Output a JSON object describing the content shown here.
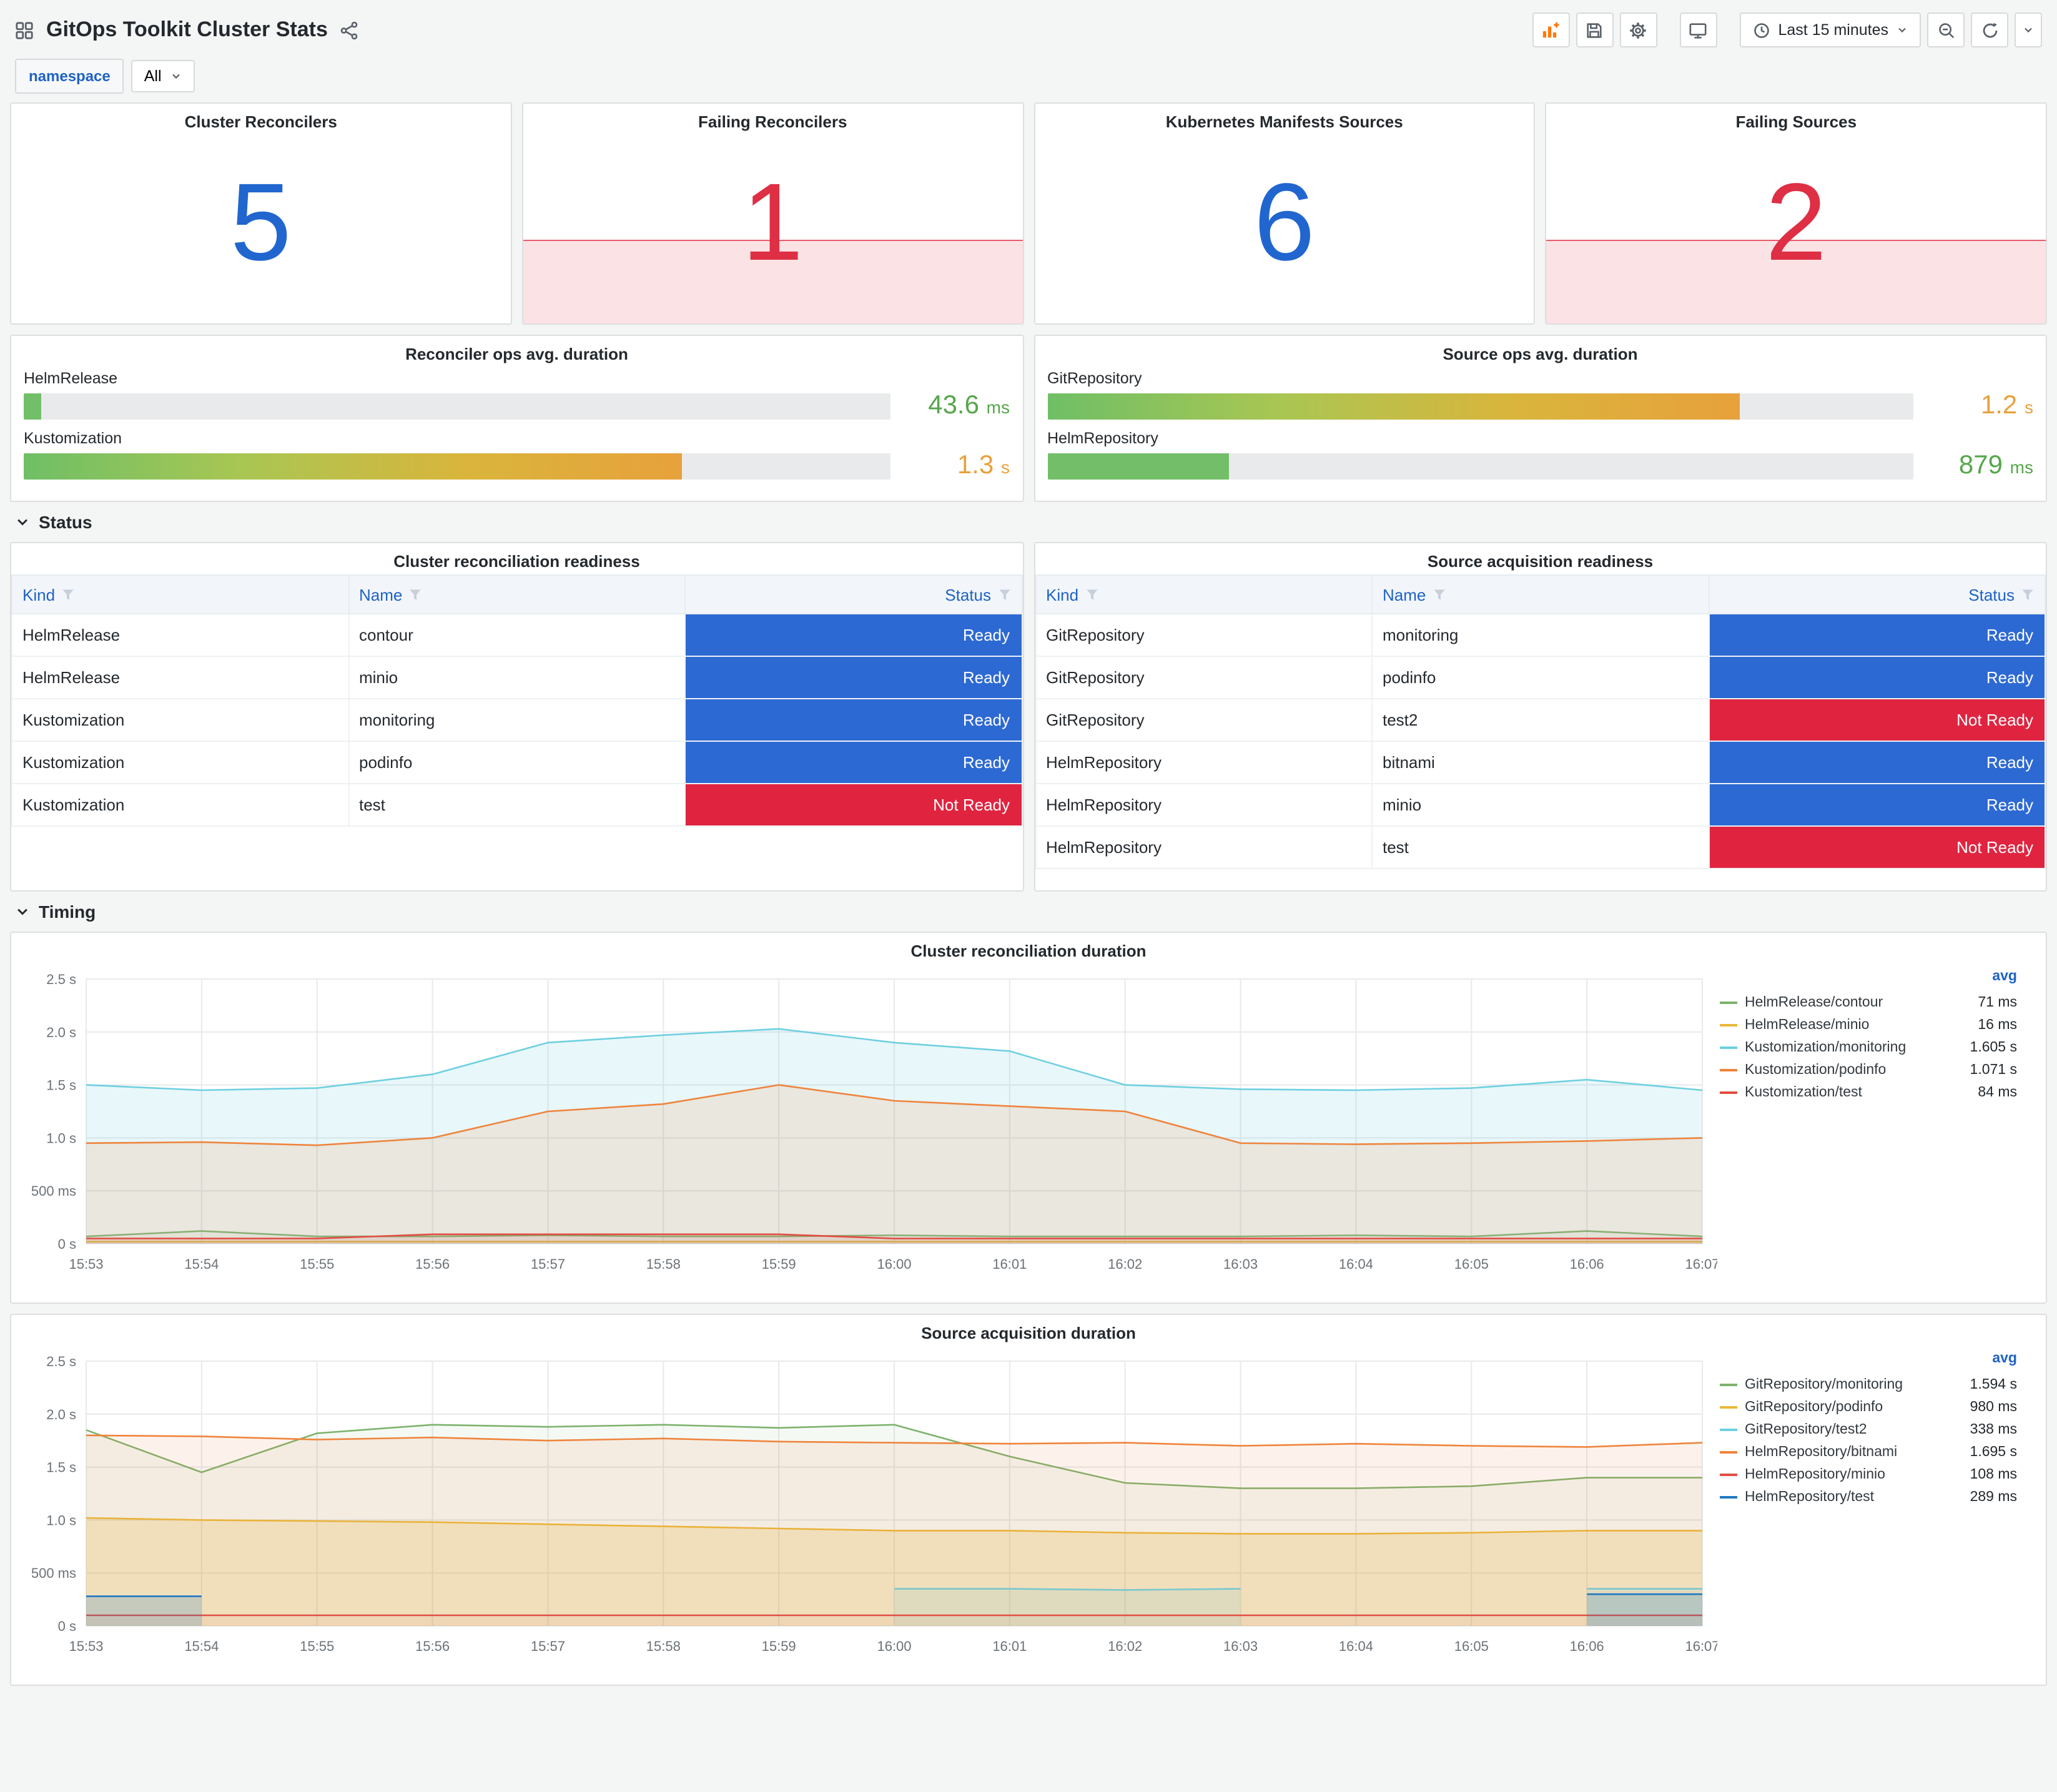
{
  "colors": {
    "stat_blue": "#2166CF",
    "stat_red": "#DE2F44",
    "ready_blue": "#2D69D3",
    "not_ready_red": "#E02440",
    "green_value": "#56A64B",
    "amber_value": "#E8A13C",
    "link_blue": "#1F62C4"
  },
  "icons": {
    "dashboard-grid-icon": "grid-of-squares",
    "share-icon": "share-nodes",
    "add-panel-icon": "bar-chart-plus (orange)",
    "save-icon": "floppy-disk",
    "settings-icon": "gear",
    "tv-icon": "monitor",
    "clock-icon": "clock",
    "zoom-out-icon": "magnifier-minus",
    "refresh-icon": "circular-arrow",
    "caret-icon": "chevron-down",
    "filter-icon": "funnel",
    "section-chevron-icon": "chevron-down"
  },
  "header": {
    "title": "GitOps Toolkit Cluster Stats",
    "time_range": "Last 15 minutes"
  },
  "variables": {
    "label": "namespace",
    "value": "All"
  },
  "sections": {
    "status": "Status",
    "timing": "Timing"
  },
  "stats": [
    {
      "title": "Cluster Reconcilers",
      "value": "5",
      "state": "ok"
    },
    {
      "title": "Failing Reconcilers",
      "value": "1",
      "state": "failing"
    },
    {
      "title": "Kubernetes Manifests Sources",
      "value": "6",
      "state": "ok"
    },
    {
      "title": "Failing Sources",
      "value": "2",
      "state": "failing"
    }
  ],
  "gauges": [
    {
      "title": "Reconciler ops avg. duration",
      "rows": [
        {
          "label": "HelmRelease",
          "num": "43.6",
          "unit": "ms",
          "pct": 2,
          "bar": "green",
          "value_color": "green"
        },
        {
          "label": "Kustomization",
          "num": "1.3",
          "unit": "s",
          "pct": 76,
          "bar": "gradient",
          "value_color": "amber"
        }
      ]
    },
    {
      "title": "Source ops avg. duration",
      "rows": [
        {
          "label": "GitRepository",
          "num": "1.2",
          "unit": "s",
          "pct": 80,
          "bar": "gradient",
          "value_color": "amber"
        },
        {
          "label": "HelmRepository",
          "num": "879",
          "unit": "ms",
          "pct": 21,
          "bar": "green",
          "value_color": "green"
        }
      ]
    }
  ],
  "tables": [
    {
      "title": "Cluster reconciliation readiness",
      "columns": [
        "Kind",
        "Name",
        "Status"
      ],
      "rows": [
        {
          "kind": "HelmRelease",
          "name": "contour",
          "status": "Ready",
          "state": "ready"
        },
        {
          "kind": "HelmRelease",
          "name": "minio",
          "status": "Ready",
          "state": "ready"
        },
        {
          "kind": "Kustomization",
          "name": "monitoring",
          "status": "Ready",
          "state": "ready"
        },
        {
          "kind": "Kustomization",
          "name": "podinfo",
          "status": "Ready",
          "state": "ready"
        },
        {
          "kind": "Kustomization",
          "name": "test",
          "status": "Not Ready",
          "state": "not-ready"
        }
      ]
    },
    {
      "title": "Source acquisition readiness",
      "columns": [
        "Kind",
        "Name",
        "Status"
      ],
      "rows": [
        {
          "kind": "GitRepository",
          "name": "monitoring",
          "status": "Ready",
          "state": "ready"
        },
        {
          "kind": "GitRepository",
          "name": "podinfo",
          "status": "Ready",
          "state": "ready"
        },
        {
          "kind": "GitRepository",
          "name": "test2",
          "status": "Not Ready",
          "state": "not-ready"
        },
        {
          "kind": "HelmRepository",
          "name": "bitnami",
          "status": "Ready",
          "state": "ready"
        },
        {
          "kind": "HelmRepository",
          "name": "minio",
          "status": "Ready",
          "state": "ready"
        },
        {
          "kind": "HelmRepository",
          "name": "test",
          "status": "Not Ready",
          "state": "not-ready"
        }
      ]
    }
  ],
  "charts": [
    {
      "type": "line",
      "title": "Cluster reconciliation duration",
      "legend_header": "avg",
      "ymax": 2.5,
      "yticks": [
        {
          "v": 0,
          "label": "0 s"
        },
        {
          "v": 0.5,
          "label": "500 ms"
        },
        {
          "v": 1,
          "label": "1.0 s"
        },
        {
          "v": 1.5,
          "label": "1.5 s"
        },
        {
          "v": 2,
          "label": "2.0 s"
        },
        {
          "v": 2.5,
          "label": "2.5 s"
        }
      ],
      "x": [
        "15:53",
        "15:54",
        "15:55",
        "15:56",
        "15:57",
        "15:58",
        "15:59",
        "16:00",
        "16:01",
        "16:02",
        "16:03",
        "16:04",
        "16:05",
        "16:06",
        "16:07"
      ],
      "series": [
        {
          "name": "HelmRelease/contour",
          "avg": "71 ms",
          "color": "#7EB26D",
          "fill": 0.06,
          "values": [
            0.07,
            0.12,
            0.07,
            0.07,
            0.08,
            0.07,
            0.07,
            0.08,
            0.07,
            0.07,
            0.07,
            0.08,
            0.07,
            0.12,
            0.07
          ]
        },
        {
          "name": "HelmRelease/minio",
          "avg": "16 ms",
          "color": "#EAB839",
          "fill": 0.05,
          "values": [
            0.02,
            0.02,
            0.02,
            0.02,
            0.02,
            0.02,
            0.02,
            0.02,
            0.02,
            0.02,
            0.02,
            0.02,
            0.02,
            0.02,
            0.02
          ]
        },
        {
          "name": "Kustomization/monitoring",
          "avg": "1.605 s",
          "color": "#6ED0E0",
          "fill": 0.16,
          "values": [
            1.5,
            1.45,
            1.47,
            1.6,
            1.9,
            1.97,
            2.03,
            1.9,
            1.82,
            1.5,
            1.46,
            1.45,
            1.47,
            1.55,
            1.45
          ]
        },
        {
          "name": "Kustomization/podinfo",
          "avg": "1.071 s",
          "color": "#EF843C",
          "fill": 0.14,
          "values": [
            0.95,
            0.96,
            0.93,
            1.0,
            1.25,
            1.32,
            1.5,
            1.35,
            1.3,
            1.25,
            0.95,
            0.94,
            0.95,
            0.97,
            1.0
          ]
        },
        {
          "name": "Kustomization/test",
          "avg": "84 ms",
          "color": "#E24D42",
          "fill": 0.1,
          "values": [
            0.05,
            0.05,
            0.05,
            0.09,
            0.09,
            0.09,
            0.09,
            0.05,
            0.05,
            0.05,
            0.05,
            0.05,
            0.05,
            0.05,
            0.05
          ]
        }
      ]
    },
    {
      "type": "line",
      "title": "Source acquisition duration",
      "legend_header": "avg",
      "ymax": 2.5,
      "yticks": [
        {
          "v": 0,
          "label": "0 s"
        },
        {
          "v": 0.5,
          "label": "500 ms"
        },
        {
          "v": 1,
          "label": "1.0 s"
        },
        {
          "v": 1.5,
          "label": "1.5 s"
        },
        {
          "v": 2,
          "label": "2.0 s"
        },
        {
          "v": 2.5,
          "label": "2.5 s"
        }
      ],
      "x": [
        "15:53",
        "15:54",
        "15:55",
        "15:56",
        "15:57",
        "15:58",
        "15:59",
        "16:00",
        "16:01",
        "16:02",
        "16:03",
        "16:04",
        "16:05",
        "16:06",
        "16:07"
      ],
      "series": [
        {
          "name": "GitRepository/monitoring",
          "avg": "1.594 s",
          "color": "#7EB26D",
          "fill": 0.08,
          "values": [
            1.85,
            1.45,
            1.82,
            1.9,
            1.88,
            1.9,
            1.87,
            1.9,
            1.6,
            1.35,
            1.3,
            1.3,
            1.32,
            1.4,
            1.4
          ]
        },
        {
          "name": "GitRepository/podinfo",
          "avg": "980 ms",
          "color": "#EAB839",
          "fill": 0.22,
          "values": [
            1.02,
            1.0,
            0.99,
            0.98,
            0.96,
            0.94,
            0.92,
            0.9,
            0.9,
            0.88,
            0.87,
            0.87,
            0.88,
            0.9,
            0.9
          ]
        },
        {
          "name": "GitRepository/test2",
          "avg": "338 ms",
          "color": "#6ED0E0",
          "fill": 0.15,
          "values": [
            null,
            null,
            null,
            null,
            null,
            null,
            null,
            0.35,
            0.35,
            0.34,
            0.35,
            null,
            null,
            0.35,
            0.35
          ]
        },
        {
          "name": "HelmRepository/bitnami",
          "avg": "1.695 s",
          "color": "#EF843C",
          "fill": 0.1,
          "values": [
            1.8,
            1.79,
            1.76,
            1.78,
            1.75,
            1.77,
            1.74,
            1.73,
            1.72,
            1.73,
            1.7,
            1.72,
            1.7,
            1.69,
            1.73
          ]
        },
        {
          "name": "HelmRepository/minio",
          "avg": "108 ms",
          "color": "#E24D42",
          "fill": 0.06,
          "values": [
            0.1,
            0.1,
            0.1,
            0.1,
            0.1,
            0.1,
            0.1,
            0.1,
            0.1,
            0.1,
            0.1,
            0.1,
            0.1,
            0.1,
            0.1
          ]
        },
        {
          "name": "HelmRepository/test",
          "avg": "289 ms",
          "color": "#1F78C1",
          "fill": 0.2,
          "values": [
            0.28,
            0.28,
            null,
            null,
            null,
            null,
            null,
            null,
            null,
            null,
            null,
            null,
            null,
            0.3,
            0.3
          ]
        }
      ]
    }
  ]
}
